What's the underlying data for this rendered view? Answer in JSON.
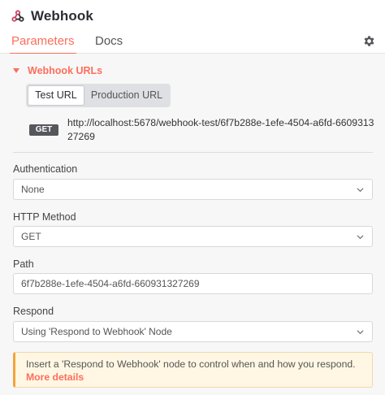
{
  "header": {
    "title": "Webhook",
    "tabs": [
      {
        "label": "Parameters",
        "active": true
      },
      {
        "label": "Docs",
        "active": false
      }
    ],
    "icon": "gear-icon"
  },
  "webhook_urls": {
    "section_label": "Webhook URLs",
    "tabs": [
      {
        "label": "Test URL",
        "active": true
      },
      {
        "label": "Production URL",
        "active": false
      }
    ],
    "method_badge": "GET",
    "url": "http://localhost:5678/webhook-test/6f7b288e-1efe-4504-a6fd-660931327269"
  },
  "fields": {
    "authentication": {
      "label": "Authentication",
      "value": "None"
    },
    "http_method": {
      "label": "HTTP Method",
      "value": "GET"
    },
    "path": {
      "label": "Path",
      "value": "6f7b288e-1efe-4504-a6fd-660931327269"
    },
    "respond": {
      "label": "Respond",
      "value": "Using 'Respond to Webhook' Node"
    }
  },
  "notice": {
    "text": "Insert a 'Respond to Webhook' node to control when and how you respond.",
    "link": "More details"
  },
  "colors": {
    "accent": "#ff6d5a",
    "notice_border": "#f1a43c"
  }
}
